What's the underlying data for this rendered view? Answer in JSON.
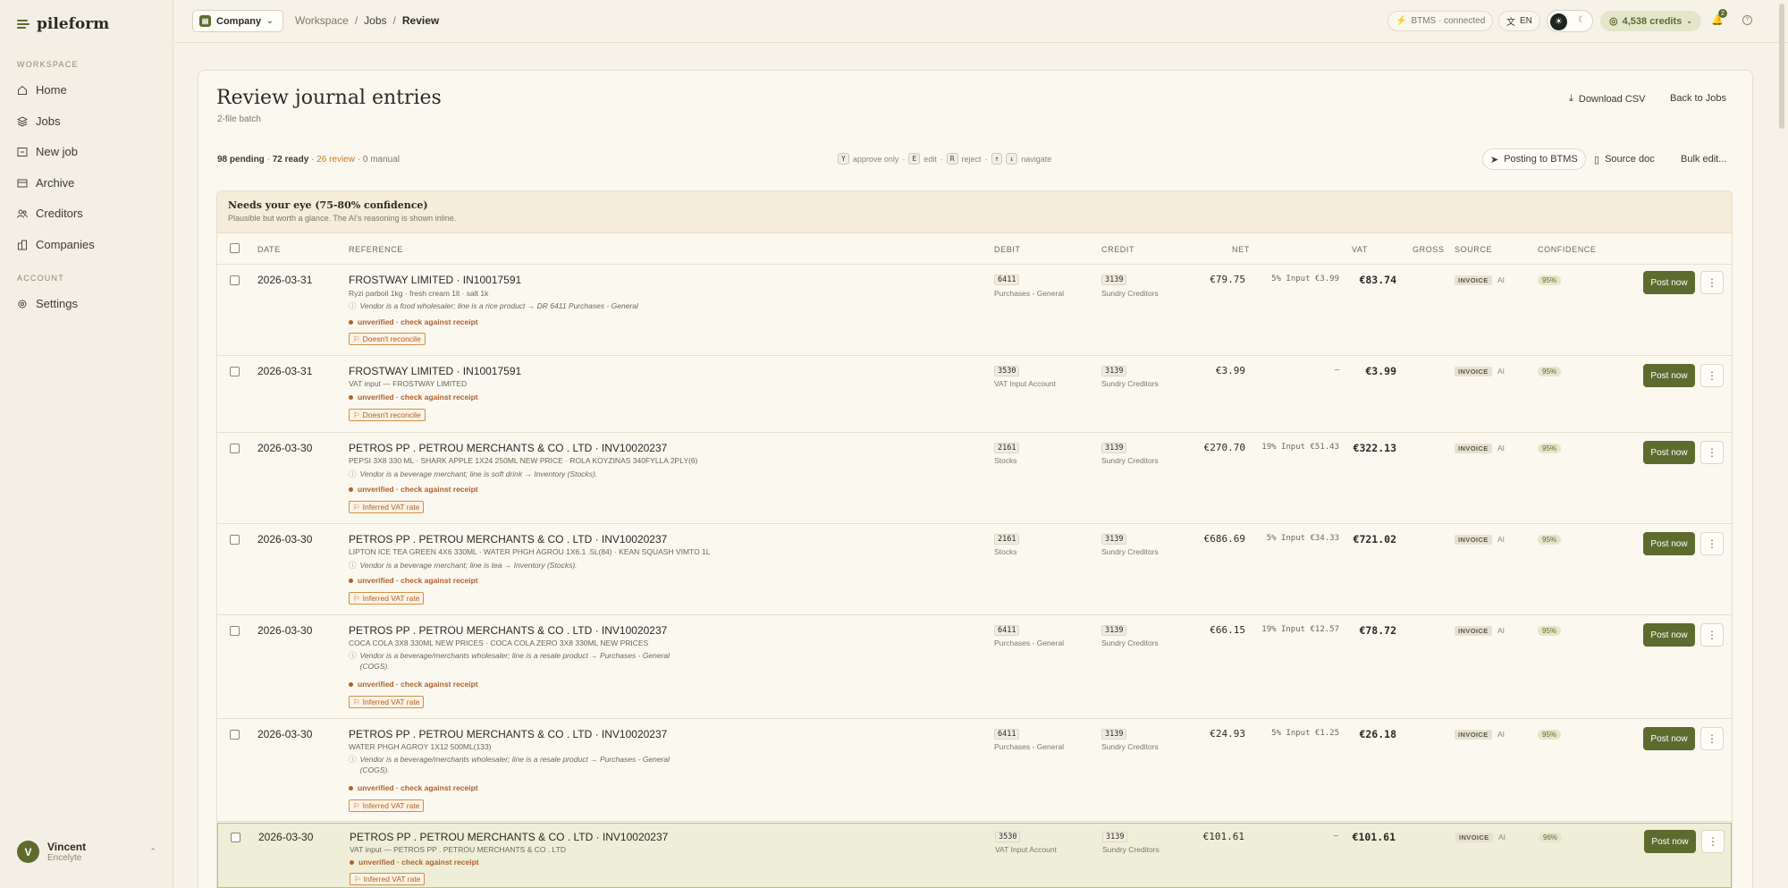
{
  "app": {
    "name": "pileform"
  },
  "sidebar": {
    "workspace_label": "WORKSPACE",
    "account_label": "ACCOUNT",
    "items": [
      {
        "label": "Home",
        "icon": "home-icon"
      },
      {
        "label": "Jobs",
        "icon": "layers-icon"
      },
      {
        "label": "New job",
        "icon": "plus-square-icon"
      },
      {
        "label": "Archive",
        "icon": "archive-icon"
      },
      {
        "label": "Creditors",
        "icon": "users-icon"
      },
      {
        "label": "Companies",
        "icon": "building-icon"
      }
    ],
    "settings": {
      "label": "Settings",
      "icon": "gear-icon"
    },
    "user": {
      "initial": "V",
      "name": "Vincent",
      "org": "Encelyte"
    }
  },
  "topbar": {
    "company": "Company",
    "breadcrumb": [
      "Workspace",
      "Jobs",
      "Review"
    ],
    "btms_status": "BTMS · connected",
    "language": "EN",
    "credits": "4,538 credits",
    "notifications": "2"
  },
  "page": {
    "title": "Review journal entries",
    "subtitle": "2-file batch",
    "download_csv": "Download CSV",
    "back": "Back to Jobs",
    "stats": {
      "pending": "98 pending",
      "ready": "72 ready",
      "review": "26 review",
      "manual": "0 manual",
      "sep": " · "
    },
    "shortcuts": [
      {
        "key": "Y",
        "label": "approve only"
      },
      {
        "key": "E",
        "label": "edit"
      },
      {
        "key": "R",
        "label": "reject"
      },
      {
        "key": "↑",
        "label": ""
      },
      {
        "key": "↓",
        "label": "navigate"
      }
    ],
    "posting_to": "Posting to BTMS",
    "source_doc": "Source doc",
    "bulk_edit": "Bulk edit..."
  },
  "group": {
    "title": "Needs your eye (75-80% confidence)",
    "subtitle": "Plausible but worth a glance. The AI's reasoning is shown inline."
  },
  "columns": {
    "date": "DATE",
    "reference": "REFERENCE",
    "debit": "DEBIT",
    "credit": "CREDIT",
    "net": "NET",
    "vat": "VAT",
    "gross": "GROSS",
    "source": "SOURCE",
    "confidence": "CONFIDENCE"
  },
  "row_labels": {
    "unverified": "unverified · check against receipt",
    "post": "Post now",
    "more": "⋮",
    "source_badge": "INVOICE",
    "source_ai": "AI"
  },
  "rows": [
    {
      "date": "2026-03-31",
      "ref": "FROSTWAY LIMITED · IN10017591",
      "desc": "Ryzi parboil 1kg · fresh cream 1lt · salt 1k",
      "reason": "Vendor is a food wholesaler; line is a rice product → DR 6411 Purchases - General",
      "flag": "Doesn't reconcile",
      "debit_code": "6411",
      "debit_name": "Purchases - General",
      "credit_code": "3139",
      "credit_name": "Sundry Creditors",
      "net": "€79.75",
      "vat": "5% Input €3.99",
      "gross": "€83.74",
      "confidence": "95%"
    },
    {
      "date": "2026-03-31",
      "ref": "FROSTWAY LIMITED · IN10017591",
      "desc": "VAT input — FROSTWAY LIMITED",
      "reason": "",
      "flag": "Doesn't reconcile",
      "debit_code": "3530",
      "debit_name": "VAT Input Account",
      "credit_code": "3139",
      "credit_name": "Sundry Creditors",
      "net": "€3.99",
      "vat": "—",
      "gross": "€3.99",
      "confidence": "95%"
    },
    {
      "date": "2026-03-30",
      "ref": "PETROS PP . PETROU MERCHANTS & CO . LTD · INV10020237",
      "desc": "PEPSI 3X8 330 ML · SHARK APPLE 1X24 250ML NEW PRICE · ROLA KOYZINAS 340FYLLA 2PLY(6)",
      "reason": "Vendor is a beverage merchant; line is soft drink → Inventory (Stocks).",
      "flag": "Inferred VAT rate",
      "debit_code": "2161",
      "debit_name": "Stocks",
      "credit_code": "3139",
      "credit_name": "Sundry Creditors",
      "net": "€270.70",
      "vat": "19% Input €51.43",
      "gross": "€322.13",
      "confidence": "95%"
    },
    {
      "date": "2026-03-30",
      "ref": "PETROS PP . PETROU MERCHANTS & CO . LTD · INV10020237",
      "desc": "LIPTON ICE TEA GREEN 4X6 330ML · WATER PHGH AGROU 1X6.1 .5L(84) · KEAN SQUASH VIMTO 1L",
      "reason": "Vendor is a beverage merchant; line is tea → Inventory (Stocks).",
      "flag": "Inferred VAT rate",
      "debit_code": "2161",
      "debit_name": "Stocks",
      "credit_code": "3139",
      "credit_name": "Sundry Creditors",
      "net": "€686.69",
      "vat": "5% Input €34.33",
      "gross": "€721.02",
      "confidence": "95%"
    },
    {
      "date": "2026-03-30",
      "ref": "PETROS PP . PETROU MERCHANTS & CO . LTD · INV10020237",
      "desc": "COCA COLA 3X8 330ML NEW PRICES · COCA COLA ZERO 3X8 330ML NEW PRICES",
      "reason": "Vendor is a beverage/merchants wholesaler; line is a resale product → Purchases - General (COGS).",
      "flag": "Inferred VAT rate",
      "debit_code": "6411",
      "debit_name": "Purchases - General",
      "credit_code": "3139",
      "credit_name": "Sundry Creditors",
      "net": "€66.15",
      "vat": "19% Input €12.57",
      "gross": "€78.72",
      "confidence": "95%"
    },
    {
      "date": "2026-03-30",
      "ref": "PETROS PP . PETROU MERCHANTS & CO . LTD · INV10020237",
      "desc": "WATER PHGH AGROY 1X12 500ML(133)",
      "reason": "Vendor is a beverage/merchants wholesaler; line is a resale product → Purchases - General (COGS).",
      "flag": "Inferred VAT rate",
      "debit_code": "6411",
      "debit_name": "Purchases - General",
      "credit_code": "3139",
      "credit_name": "Sundry Creditors",
      "net": "€24.93",
      "vat": "5% Input €1.25",
      "gross": "€26.18",
      "confidence": "95%"
    },
    {
      "date": "2026-03-30",
      "ref": "PETROS PP . PETROU MERCHANTS & CO . LTD · INV10020237",
      "desc": "VAT input — PETROS PP . PETROU MERCHANTS & CO . LTD",
      "reason": "",
      "flag": "Inferred VAT rate",
      "debit_code": "3530",
      "debit_name": "VAT Input Account",
      "credit_code": "3139",
      "credit_name": "Sundry Creditors",
      "net": "€101.61",
      "vat": "—",
      "gross": "€101.61",
      "confidence": "96%"
    }
  ]
}
